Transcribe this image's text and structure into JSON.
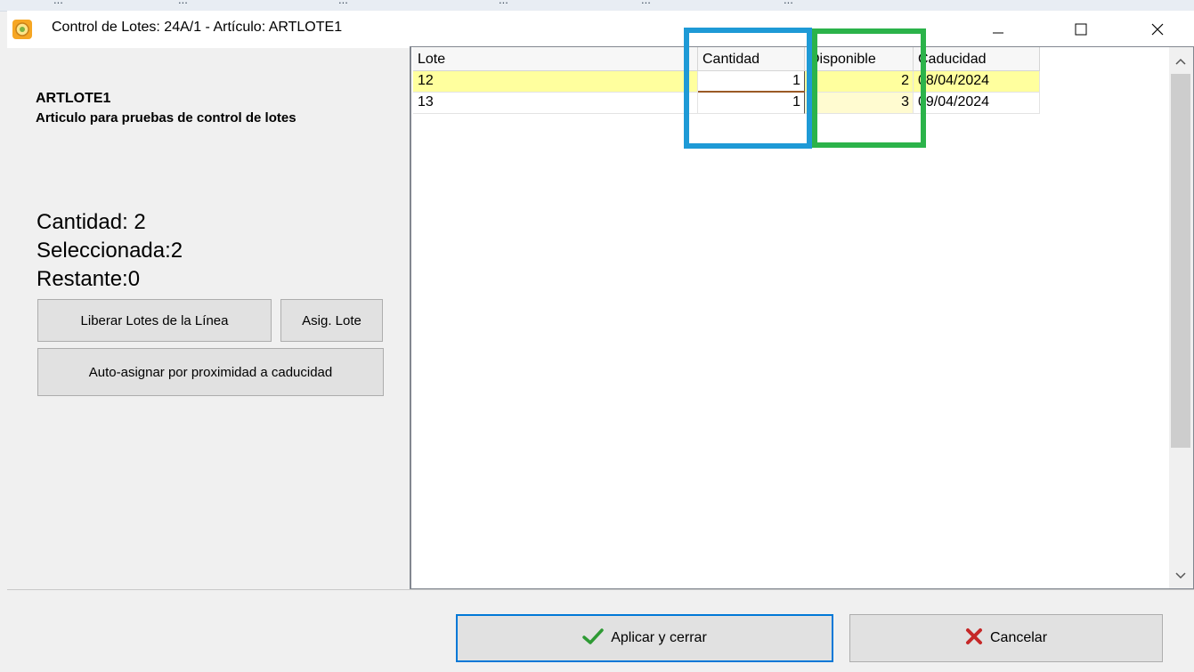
{
  "background": {
    "fragments": [
      "...",
      "...",
      "...",
      "...",
      "...",
      "..."
    ]
  },
  "window": {
    "title": "Control de Lotes: 24A/1 - Artículo: ARTLOTE1",
    "controls": {
      "minimize": "minimize-icon",
      "maximize": "maximize-icon",
      "close": "close-icon"
    }
  },
  "article": {
    "code": "ARTLOTE1",
    "description": "Articulo para pruebas de control de lotes"
  },
  "stats": {
    "cantidad": "Cantidad: 2",
    "seleccionada": "Seleccionada:2",
    "restante": "Restante:0"
  },
  "buttons": {
    "liberar": "Liberar Lotes de la Línea",
    "asig": "Asig. Lote",
    "auto": "Auto-asignar por proximidad a caducidad",
    "aplicar": "Aplicar y cerrar",
    "cancelar": "Cancelar"
  },
  "grid": {
    "columns": [
      "Lote",
      "Cantidad",
      "Disponible",
      "Caducidad"
    ],
    "rows": [
      {
        "lote": "12",
        "cantidad": "1",
        "disponible": "2",
        "caducidad": "08/04/2024"
      },
      {
        "lote": "13",
        "cantidad": "1",
        "disponible": "3",
        "caducidad": "09/04/2024"
      }
    ]
  },
  "colors": {
    "selected_row": "#ffff9e",
    "annotation_blue": "#1e9ad6",
    "annotation_green": "#2bb34a",
    "default_button_border": "#0078d7"
  }
}
